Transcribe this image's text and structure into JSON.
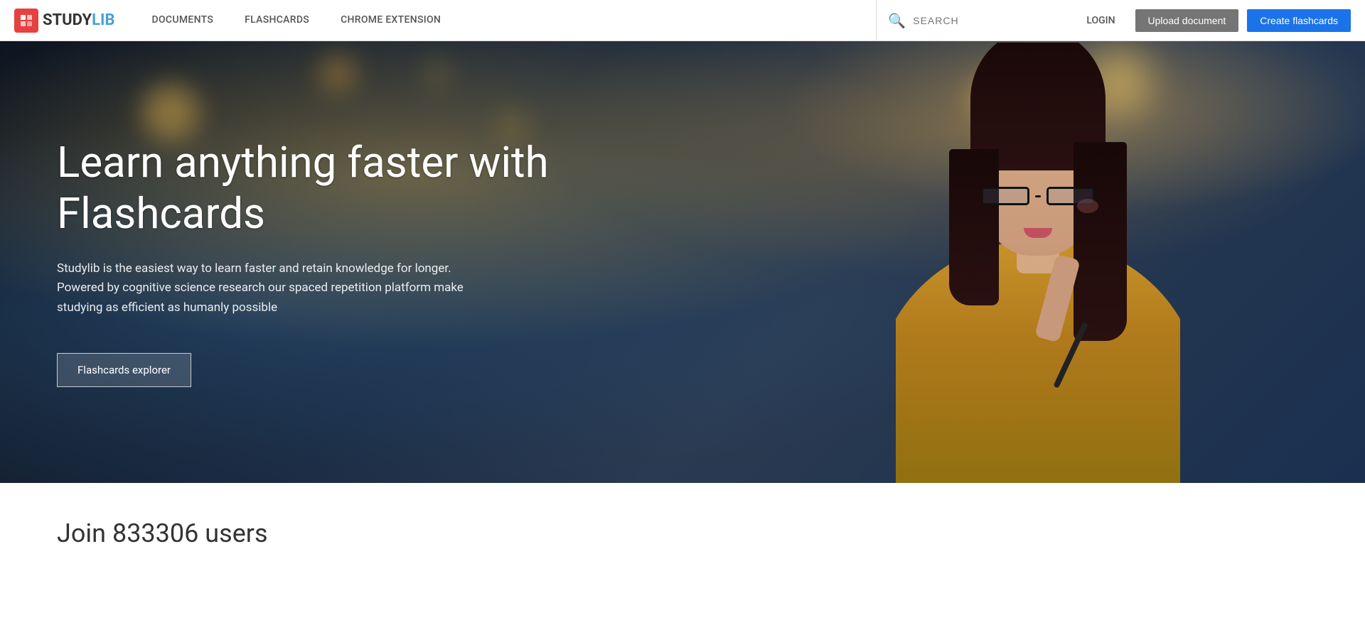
{
  "navbar": {
    "logo_text_study": "STUDY",
    "logo_text_lib": "LIB",
    "nav_items": [
      {
        "label": "DOCUMENTS",
        "id": "documents"
      },
      {
        "label": "FLASHCARDS",
        "id": "flashcards"
      },
      {
        "label": "CHROME EXTENSION",
        "id": "chrome-extension"
      }
    ],
    "search_placeholder": "SEARCH",
    "login_label": "LOGIN",
    "upload_label": "Upload document",
    "create_label": "Create flashcards"
  },
  "hero": {
    "title": "Learn anything faster with Flashcards",
    "description": "Studylib is the easiest way to learn faster and retain knowledge for longer. Powered by cognitive science research our spaced repetition platform make studying as efficient as humanly possible",
    "cta_label": "Flashcards explorer"
  },
  "below_hero": {
    "join_title": "Join 833306 users"
  }
}
